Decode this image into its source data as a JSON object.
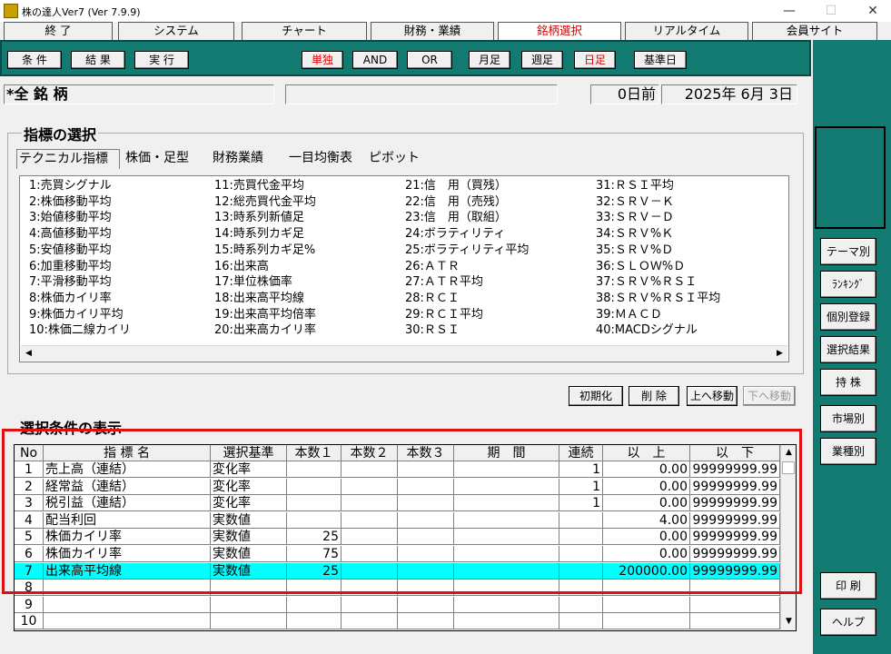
{
  "window": {
    "title": "株の達人Ver7 (Ver 7.9.9)",
    "min": "—",
    "max": "☐",
    "close": "✕"
  },
  "menu": [
    "終 了",
    "システム",
    "チャート",
    "財務・業績",
    "銘柄選択",
    "リアルタイム",
    "会員サイト"
  ],
  "toolbar": {
    "left": [
      "条 件",
      "結 果",
      "実 行"
    ],
    "mid": [
      "単独",
      "AND",
      "OR"
    ],
    "right": [
      "月足",
      "週足",
      "日足",
      "基準日"
    ]
  },
  "status": {
    "name": "*全 銘 柄",
    "middle": "",
    "days": "0日前",
    "date": "2025年 6月 3日"
  },
  "indicators": {
    "group_title": "指標の選択",
    "tabs": [
      "テクニカル指標",
      "株価・足型",
      "財務業績",
      "一目均衡表",
      "ピボット"
    ],
    "col1": [
      "1:売買シグナル",
      "2:株価移動平均",
      "3:始値移動平均",
      "4:高値移動平均",
      "5:安値移動平均",
      "6:加重移動平均",
      "7:平滑移動平均",
      "8:株価カイリ率",
      "9:株価カイリ平均",
      "10:株価二線カイリ"
    ],
    "col2": [
      "11:売買代金平均",
      "12:総売買代金平均",
      "13:時系列新値足",
      "14:時系列カギ足",
      "15:時系列カギ足%",
      "16:出来高",
      "17:単位株価率",
      "18:出来高平均線",
      "19:出来高平均倍率",
      "20:出来高カイリ率"
    ],
    "col3": [
      "21:信　用（買残）",
      "22:信　用（売残）",
      "23:信　用（取組）",
      "24:ボラティリティ",
      "25:ボラティリティ平均",
      "26:ＡＴＲ",
      "27:ＡＴＲ平均",
      "28:ＲＣＩ",
      "29:ＲＣＩ平均",
      "30:ＲＳＩ"
    ],
    "col4": [
      "31:ＲＳＩ平均",
      "32:ＳＲＶ－Ｋ",
      "33:ＳＲＶ－Ｄ",
      "34:ＳＲＶ%Ｋ",
      "35:ＳＲＶ%Ｄ",
      "36:ＳＬＯＷ%Ｄ",
      "37:ＳＲＶ%ＲＳＩ",
      "38:ＳＲＶ%ＲＳＩ平均",
      "39:ＭＡＣＤ",
      "40:MACDシグナル"
    ]
  },
  "actions": [
    "初期化",
    "削 除",
    "上へ移動",
    "下へ移動"
  ],
  "conditions": {
    "title": "選択条件の表示",
    "headers": [
      "No",
      "指 標 名",
      "選択基準",
      "本数１",
      "本数２",
      "本数３",
      "期　間",
      "連続",
      "以　上",
      "以　下"
    ],
    "rows": [
      [
        "1",
        "売上高（連結）",
        "変化率",
        "",
        "",
        "",
        "",
        "1",
        "0.00",
        "99999999.99"
      ],
      [
        "2",
        "経常益（連結）",
        "変化率",
        "",
        "",
        "",
        "",
        "1",
        "0.00",
        "99999999.99"
      ],
      [
        "3",
        "税引益（連結）",
        "変化率",
        "",
        "",
        "",
        "",
        "1",
        "0.00",
        "99999999.99"
      ],
      [
        "4",
        "配当利回",
        "実数値",
        "",
        "",
        "",
        "",
        "",
        "4.00",
        "99999999.99"
      ],
      [
        "5",
        "株価カイリ率",
        "実数値",
        "25",
        "",
        "",
        "",
        "",
        "0.00",
        "99999999.99"
      ],
      [
        "6",
        "株価カイリ率",
        "実数値",
        "75",
        "",
        "",
        "",
        "",
        "0.00",
        "99999999.99"
      ],
      [
        "7",
        "出来高平均線",
        "実数値",
        "25",
        "",
        "",
        "",
        "",
        "200000.00",
        "99999999.99"
      ],
      [
        "8",
        "",
        "",
        "",
        "",
        "",
        "",
        "",
        "",
        ""
      ],
      [
        "9",
        "",
        "",
        "",
        "",
        "",
        "",
        "",
        "",
        ""
      ],
      [
        "10",
        "",
        "",
        "",
        "",
        "",
        "",
        "",
        "",
        ""
      ]
    ],
    "selected_row": 7
  },
  "side": [
    "テーマ別",
    "ﾗﾝｷﾝｸﾞ",
    "個別登録",
    "選択結果",
    "持 株",
    "市場別",
    "業種別"
  ],
  "bottom": [
    "印 刷",
    "ヘルプ"
  ],
  "colors": {
    "teal": "#137a72",
    "selected": "#00ffff",
    "highlight": "#e01010",
    "active_tab": "#d00000"
  }
}
